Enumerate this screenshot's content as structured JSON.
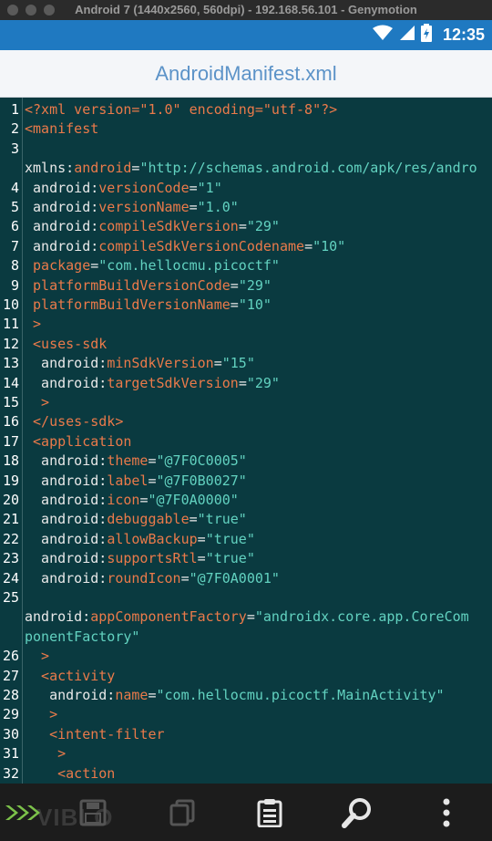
{
  "window": {
    "title": "Android 7 (1440x2560, 560dpi) - 192.168.56.101 - Genymotion"
  },
  "statusbar": {
    "time": "12:35"
  },
  "app": {
    "title": "AndroidManifest.xml"
  },
  "code_lines": [
    {
      "n": "1",
      "parts": [
        [
          "t",
          "<?xml version=\"1.0\" encoding=\"utf-8\"?>"
        ]
      ]
    },
    {
      "n": "2",
      "parts": [
        [
          "t",
          "<manifest"
        ]
      ]
    },
    {
      "n": "3",
      "parts": []
    },
    {
      "n": "",
      "parts": [
        [
          "n",
          "xmlns:"
        ],
        [
          "a",
          "android"
        ],
        [
          "e",
          "="
        ],
        [
          "v",
          "\"http://schemas.android.com/apk/res/andro"
        ]
      ]
    },
    {
      "n": "4",
      "parts": [
        [
          "n",
          " android:"
        ],
        [
          "a",
          "versionCode"
        ],
        [
          "e",
          "="
        ],
        [
          "v",
          "\"1\""
        ]
      ]
    },
    {
      "n": "5",
      "parts": [
        [
          "n",
          " android:"
        ],
        [
          "a",
          "versionName"
        ],
        [
          "e",
          "="
        ],
        [
          "v",
          "\"1.0\""
        ]
      ]
    },
    {
      "n": "6",
      "parts": [
        [
          "n",
          " android:"
        ],
        [
          "a",
          "compileSdkVersion"
        ],
        [
          "e",
          "="
        ],
        [
          "v",
          "\"29\""
        ]
      ]
    },
    {
      "n": "7",
      "parts": [
        [
          "n",
          " android:"
        ],
        [
          "a",
          "compileSdkVersionCodename"
        ],
        [
          "e",
          "="
        ],
        [
          "v",
          "\"10\""
        ]
      ]
    },
    {
      "n": "8",
      "parts": [
        [
          "a",
          " package"
        ],
        [
          "e",
          "="
        ],
        [
          "v",
          "\"com.hellocmu.picoctf\""
        ]
      ]
    },
    {
      "n": "9",
      "parts": [
        [
          "a",
          " platformBuildVersionCode"
        ],
        [
          "e",
          "="
        ],
        [
          "v",
          "\"29\""
        ]
      ]
    },
    {
      "n": "10",
      "parts": [
        [
          "a",
          " platformBuildVersionName"
        ],
        [
          "e",
          "="
        ],
        [
          "v",
          "\"10\""
        ]
      ]
    },
    {
      "n": "11",
      "parts": [
        [
          "t",
          " >"
        ]
      ]
    },
    {
      "n": "12",
      "parts": [
        [
          "t",
          " <uses-sdk"
        ]
      ]
    },
    {
      "n": "13",
      "parts": [
        [
          "n",
          "  android:"
        ],
        [
          "a",
          "minSdkVersion"
        ],
        [
          "e",
          "="
        ],
        [
          "v",
          "\"15\""
        ]
      ]
    },
    {
      "n": "14",
      "parts": [
        [
          "n",
          "  android:"
        ],
        [
          "a",
          "targetSdkVersion"
        ],
        [
          "e",
          "="
        ],
        [
          "v",
          "\"29\""
        ]
      ]
    },
    {
      "n": "15",
      "parts": [
        [
          "t",
          "  >"
        ]
      ]
    },
    {
      "n": "16",
      "parts": [
        [
          "t",
          " </uses-sdk>"
        ]
      ]
    },
    {
      "n": "17",
      "parts": [
        [
          "t",
          " <application"
        ]
      ]
    },
    {
      "n": "18",
      "parts": [
        [
          "n",
          "  android:"
        ],
        [
          "a",
          "theme"
        ],
        [
          "e",
          "="
        ],
        [
          "v",
          "\"@7F0C0005\""
        ]
      ]
    },
    {
      "n": "19",
      "parts": [
        [
          "n",
          "  android:"
        ],
        [
          "a",
          "label"
        ],
        [
          "e",
          "="
        ],
        [
          "v",
          "\"@7F0B0027\""
        ]
      ]
    },
    {
      "n": "20",
      "parts": [
        [
          "n",
          "  android:"
        ],
        [
          "a",
          "icon"
        ],
        [
          "e",
          "="
        ],
        [
          "v",
          "\"@7F0A0000\""
        ]
      ]
    },
    {
      "n": "21",
      "parts": [
        [
          "n",
          "  android:"
        ],
        [
          "a",
          "debuggable"
        ],
        [
          "e",
          "="
        ],
        [
          "v",
          "\"true\""
        ]
      ]
    },
    {
      "n": "22",
      "parts": [
        [
          "n",
          "  android:"
        ],
        [
          "a",
          "allowBackup"
        ],
        [
          "e",
          "="
        ],
        [
          "v",
          "\"true\""
        ]
      ]
    },
    {
      "n": "23",
      "parts": [
        [
          "n",
          "  android:"
        ],
        [
          "a",
          "supportsRtl"
        ],
        [
          "e",
          "="
        ],
        [
          "v",
          "\"true\""
        ]
      ]
    },
    {
      "n": "24",
      "parts": [
        [
          "n",
          "  android:"
        ],
        [
          "a",
          "roundIcon"
        ],
        [
          "e",
          "="
        ],
        [
          "v",
          "\"@7F0A0001\""
        ]
      ]
    },
    {
      "n": "25",
      "parts": []
    },
    {
      "n": "",
      "parts": [
        [
          "n",
          "android:"
        ],
        [
          "a",
          "appComponentFactory"
        ],
        [
          "e",
          "="
        ],
        [
          "v",
          "\"androidx.core.app.CoreCom"
        ]
      ]
    },
    {
      "n": "",
      "parts": [
        [
          "v",
          "ponentFactory\""
        ]
      ]
    },
    {
      "n": "26",
      "parts": [
        [
          "t",
          "  >"
        ]
      ]
    },
    {
      "n": "27",
      "parts": [
        [
          "t",
          "  <activity"
        ]
      ]
    },
    {
      "n": "28",
      "parts": [
        [
          "n",
          "   android:"
        ],
        [
          "a",
          "name"
        ],
        [
          "e",
          "="
        ],
        [
          "v",
          "\"com.hellocmu.picoctf.MainActivity\""
        ]
      ]
    },
    {
      "n": "29",
      "parts": [
        [
          "t",
          "   >"
        ]
      ]
    },
    {
      "n": "30",
      "parts": [
        [
          "t",
          "   <intent-filter"
        ]
      ]
    },
    {
      "n": "31",
      "parts": [
        [
          "t",
          "    >"
        ]
      ]
    },
    {
      "n": "32",
      "parts": [
        [
          "t",
          "    <action"
        ]
      ]
    }
  ],
  "toolbar": {
    "items": [
      "share-icon",
      "save-icon",
      "copy-icon",
      "clipboard-icon",
      "search-icon",
      "more-icon"
    ],
    "watermark": "VIBLO"
  },
  "colors": {
    "tag": "#ea7a4a",
    "value": "#62d2c0",
    "statusbar": "#1f79c1",
    "background": "#0a3a40"
  }
}
